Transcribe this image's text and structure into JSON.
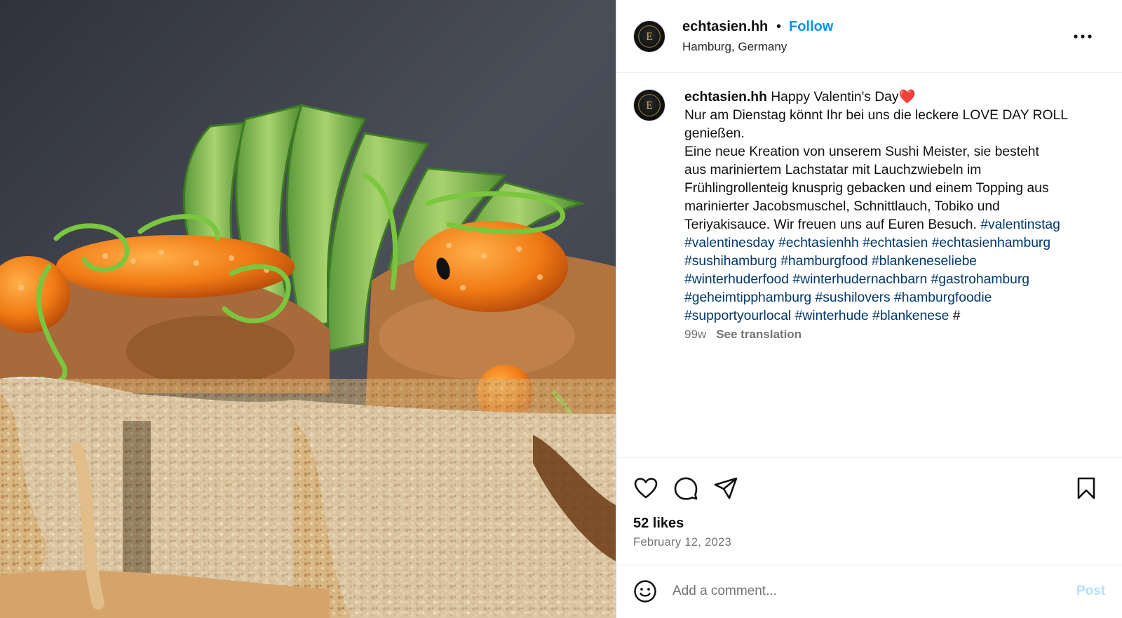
{
  "photo": {
    "alt_subject": "sushi-roll-photo"
  },
  "header": {
    "username": "echtasien.hh",
    "separator": "•",
    "follow_label": "Follow",
    "location": "Hamburg, Germany",
    "avatar_text": "ECHTASIEN"
  },
  "caption": {
    "username": "echtasien.hh",
    "line1_text": "Happy Valentin's Day❤️",
    "line2": "Nur am Dienstag könnt Ihr bei uns die leckere LOVE DAY ROLL",
    "line3": "genießen.",
    "line4": "Eine neue Kreation von unserem Sushi Meister, sie besteht",
    "line5": "aus mariniertem Lachstatar mit Lauchzwiebeln im",
    "line6": "Frühlingrollenteig knusprig gebacken und einem Topping aus",
    "line7": "marinierter Jacobsmuschel, Schnittlauch, Tobiko und",
    "line8_text": "Teriyakisauce. Wir freuen uns auf Euren Besuch.",
    "hashtags": [
      "#valentinstag",
      "#valentinesday",
      "#echtasienhh",
      "#echtasien",
      "#echtasienhamburg",
      "#sushihamburg",
      "#hamburgfood",
      "#blankeneseliebe",
      "#winterhuderfood",
      "#winterhudernachbarn",
      "#gastrohamburg",
      "#geheimtipphamburg",
      "#sushilovers",
      "#hamburgfoodie",
      "#supportyourlocal",
      "#winterhude",
      "#blankenese"
    ],
    "trailing": "#",
    "age": "99w",
    "see_translation": "See translation"
  },
  "actions": {
    "icons": [
      "heart-icon",
      "comment-icon",
      "share-icon",
      "bookmark-icon"
    ]
  },
  "likes": "52 likes",
  "date": "February 12, 2023",
  "comment": {
    "placeholder": "Add a comment...",
    "post_label": "Post"
  },
  "colors": {
    "follow": "#0095f6",
    "hashtag": "#00376b",
    "muted": "#737373",
    "post_disabled": "#b2dffc"
  }
}
